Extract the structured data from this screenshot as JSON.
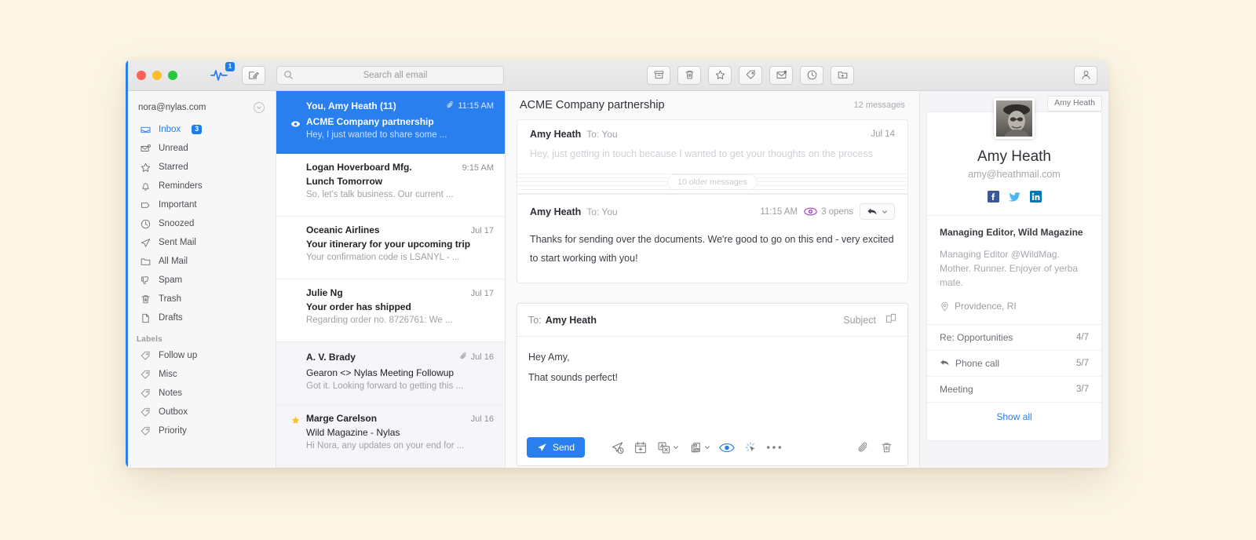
{
  "window": {
    "traffic_lights": [
      "close",
      "minimize",
      "maximize"
    ],
    "pulse_badge": "1"
  },
  "search": {
    "placeholder": "Search all email",
    "value": ""
  },
  "toolbar": {
    "center_icons": [
      {
        "name": "archive-icon",
        "label": "Archive"
      },
      {
        "name": "trash-icon",
        "label": "Trash"
      },
      {
        "name": "star-icon",
        "label": "Star"
      },
      {
        "name": "tag-icon",
        "label": "Label"
      },
      {
        "name": "mark-unread-icon",
        "label": "Mark Unread"
      },
      {
        "name": "snooze-clock-icon",
        "label": "Snooze"
      },
      {
        "name": "move-to-folder-icon",
        "label": "Move to folder"
      }
    ],
    "right_icons": [
      {
        "name": "contact-person-icon",
        "label": "Contact"
      }
    ],
    "compose_label": "Compose"
  },
  "sidebar": {
    "account_email": "nora@nylas.com",
    "items": [
      {
        "label": "Inbox",
        "icon": "inbox-icon",
        "badge": "3",
        "active": true
      },
      {
        "label": "Unread",
        "icon": "unread-envelope-icon",
        "badge": "",
        "active": false
      },
      {
        "label": "Starred",
        "icon": "star-icon",
        "badge": "",
        "active": false
      },
      {
        "label": "Reminders",
        "icon": "bell-icon",
        "badge": "",
        "active": false
      },
      {
        "label": "Important",
        "icon": "tag-outline-icon",
        "badge": "",
        "active": false
      },
      {
        "label": "Snoozed",
        "icon": "clock-icon",
        "badge": "",
        "active": false
      },
      {
        "label": "Sent Mail",
        "icon": "paper-plane-icon",
        "badge": "",
        "active": false
      },
      {
        "label": "All Mail",
        "icon": "folder-icon",
        "badge": "",
        "active": false
      },
      {
        "label": "Spam",
        "icon": "thumbs-down-icon",
        "badge": "",
        "active": false
      },
      {
        "label": "Trash",
        "icon": "trash-icon",
        "badge": "",
        "active": false
      },
      {
        "label": "Drafts",
        "icon": "document-icon",
        "badge": "",
        "active": false
      }
    ],
    "labels_section_title": "Labels",
    "labels": [
      {
        "label": "Follow up",
        "icon": "tag-icon"
      },
      {
        "label": "Misc",
        "icon": "tag-icon"
      },
      {
        "label": "Notes",
        "icon": "tag-icon"
      },
      {
        "label": "Outbox",
        "icon": "tag-icon"
      },
      {
        "label": "Priority",
        "icon": "tag-icon"
      }
    ]
  },
  "mail_list": [
    {
      "from": "You, Amy Heath (11)",
      "subject": "ACME Company partnership",
      "snippet": "Hey, I just wanted to share some ...",
      "date": "11:15 AM",
      "selected": true,
      "read": false,
      "marker": "eye-icon",
      "attachment": true
    },
    {
      "from": "Logan Hoverboard Mfg.",
      "subject": "Lunch Tomorrow",
      "snippet": "So, let's talk business. Our current ...",
      "date": "9:15 AM",
      "selected": false,
      "read": false,
      "marker": "unread-dot",
      "attachment": false
    },
    {
      "from": "Oceanic Airlines",
      "subject": "Your itinerary for your upcoming trip",
      "snippet": "Your confirmation code is LSANYL - ...",
      "date": "Jul 17",
      "selected": false,
      "read": false,
      "marker": "unread-dot",
      "attachment": false
    },
    {
      "from": "Julie Ng",
      "subject": "Your order has shipped",
      "snippet": "Regarding order no. 8726761: We ...",
      "date": "Jul 17",
      "selected": false,
      "read": false,
      "marker": "unread-dot",
      "attachment": false
    },
    {
      "from": "A. V. Brady",
      "subject": "Gearon <> Nylas Meeting Followup",
      "snippet": "Got it. Looking forward to getting this ...",
      "date": "Jul 16",
      "selected": false,
      "read": true,
      "marker": "none",
      "attachment": true
    },
    {
      "from": "Marge Carelson",
      "subject": "Wild Magazine - Nylas",
      "snippet": "Hi Nora, any updates on your end for ...",
      "date": "Jul 16",
      "selected": false,
      "read": true,
      "marker": "star-icon",
      "attachment": false
    }
  ],
  "thread": {
    "subject": "ACME Company partnership",
    "message_count": "12 messages",
    "older_messages_label": "10 older messages",
    "messages": [
      {
        "sender": "Amy Heath",
        "to": "To: You",
        "date": "Jul 14",
        "body": "Hey, just getting in touch because I wanted to get your thoughts on the process",
        "collapsed": true
      },
      {
        "sender": "Amy Heath",
        "to": "To: You",
        "date": "11:15 AM",
        "opens": "3 opens",
        "body": "Thanks for sending over the documents. We're good to go on this end - very excited to start working with you!",
        "collapsed": false
      }
    ]
  },
  "composer": {
    "to_label": "To:",
    "to_value": "Amy Heath",
    "subject_label": "Subject",
    "body_line1": "Hey Amy,",
    "body_line2": "That sounds perfect!",
    "send_label": "Send",
    "footer_tools": [
      {
        "name": "send-later-icon",
        "label": "Send later"
      },
      {
        "name": "calendar-add-icon",
        "label": "Insert availability"
      },
      {
        "name": "translate-icon",
        "label": "Translate",
        "caret": true
      },
      {
        "name": "template-icon",
        "label": "Templates",
        "caret": true
      },
      {
        "name": "read-receipt-eye-icon",
        "label": "Read receipts",
        "active": true
      },
      {
        "name": "link-tracking-icon",
        "label": "Link tracking",
        "active": true
      },
      {
        "name": "more-options-icon",
        "label": "More"
      }
    ],
    "right_tools": [
      {
        "name": "attachment-paperclip-icon",
        "label": "Attach file"
      },
      {
        "name": "discard-draft-trash-icon",
        "label": "Discard draft"
      }
    ]
  },
  "contact": {
    "pill_label": "Amy Heath",
    "name": "Amy Heath",
    "email": "amy@heathmail.com",
    "socials": [
      {
        "name": "facebook-icon",
        "glyph": "f",
        "color": "#3b5998"
      },
      {
        "name": "twitter-icon",
        "glyph": "t",
        "color": "#4db5f5"
      },
      {
        "name": "linkedin-icon",
        "glyph": "in",
        "color": "#0077b5"
      }
    ],
    "title": "Managing Editor, Wild Magazine",
    "description": "Managing Editor @WildMag. Mother. Runner. Enjoyer of yerba mate.",
    "location": "Providence, RI",
    "topics": [
      {
        "label": "Re: Opportunities",
        "count": "4/7",
        "icon": "none"
      },
      {
        "label": "Phone call",
        "count": "5/7",
        "icon": "reply-arrow-icon"
      },
      {
        "label": "Meeting",
        "count": "3/7",
        "icon": "none"
      }
    ],
    "show_all_label": "Show all"
  },
  "colors": {
    "accent": "#2a7fef",
    "page_background": "#fdf6e6",
    "sidebar_background": "#f7f7f8",
    "opens_purple": "#a64bd6"
  }
}
